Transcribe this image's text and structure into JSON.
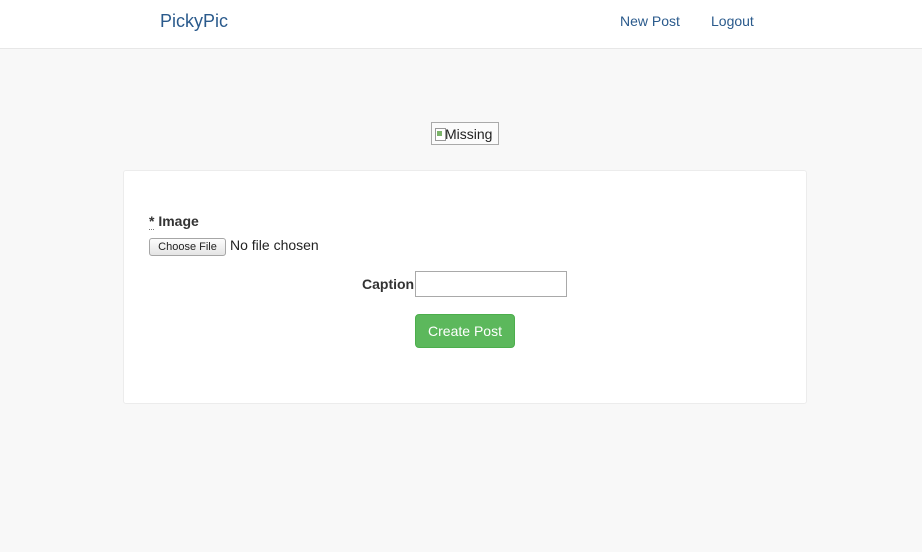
{
  "navbar": {
    "brand": "PickyPic",
    "links": [
      {
        "label": "New Post"
      },
      {
        "label": "Logout"
      }
    ]
  },
  "preview": {
    "alt_text": "Missing"
  },
  "form": {
    "image_required_mark": "*",
    "image_label": "Image",
    "file_button_label": "Choose File",
    "file_status": "No file chosen",
    "caption_label": "Caption",
    "caption_value": "",
    "submit_label": "Create Post"
  },
  "colors": {
    "link": "#2a5a8c",
    "submit": "#5cb85c",
    "background": "#f8f8f8"
  },
  "icons": {
    "preview": "broken-image-icon"
  }
}
